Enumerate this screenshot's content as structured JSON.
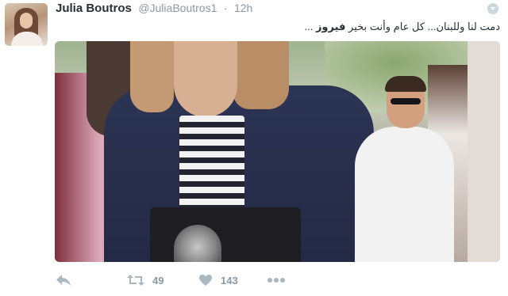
{
  "tweet": {
    "author_name": "Julia Boutros",
    "author_handle": "@JuliaBoutros1",
    "separator": "·",
    "timestamp": "12h",
    "text_plain": "دمت لنا وللبنان... كل عام وأنت بخير ",
    "text_bold": "فيروز",
    "text_end": " ..."
  },
  "actions": {
    "reply_icon": "reply-arrow-icon",
    "retweet_icon": "retweet-icon",
    "retweet_count": "49",
    "like_icon": "heart-icon",
    "like_count": "143",
    "more_icon": "ellipsis-icon"
  },
  "colors": {
    "name": "#292f33",
    "meta": "#8899a6",
    "icons": "#aab8c2"
  }
}
